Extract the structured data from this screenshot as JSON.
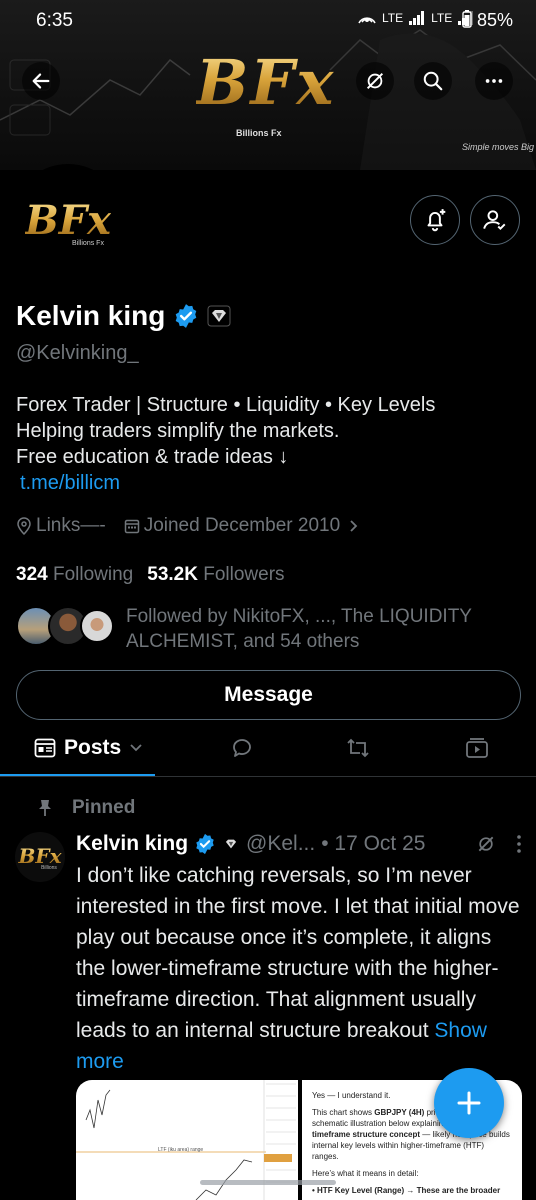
{
  "status_bar": {
    "time": "6:35",
    "network": "LTE",
    "network2": "LTE",
    "battery": "85%"
  },
  "banner": {
    "logo": "BFx",
    "logo_sub": "Billions Fx",
    "tagline": "Simple moves Big wi"
  },
  "avatar": {
    "logo": "BFx",
    "sub": "Billions Fx"
  },
  "profile": {
    "name": "Kelvin king",
    "handle": "@Kelvinking_",
    "bio_line1": "Forex Trader | Structure • Liquidity • Key Levels",
    "bio_line2": "Helping traders simplify the markets.",
    "bio_line3": "Free education & trade ideas ↓",
    "bio_link": "t.me/billicm",
    "location": "Links—-",
    "joined": "Joined December 2010",
    "following_count": "324",
    "following_label": "Following",
    "followers_count": "53.2K",
    "followers_label": "Followers",
    "followed_by": "Followed by NikitoFX, ..., The LIQUIDITY ALCHEMIST, and 54 others"
  },
  "actions": {
    "message_label": "Message"
  },
  "tabs": {
    "posts_label": "Posts"
  },
  "pinned": {
    "label": "Pinned"
  },
  "post": {
    "avatar_logo": "BFx",
    "avatar_sub": "Billions",
    "name": "Kelvin king",
    "handle": "@Kel...",
    "date": "• 17 Oct 25",
    "text": "I don’t like catching reversals, so I’m never interested in the first move. I let that initial move play out because once it’s complete, it aligns the lower-timeframe structure with the higher-timeframe direction. That alignment usually leads to an internal structure breakout",
    "show_more": "Show more",
    "media_chart_label": "LTF (iku area) range",
    "media_para1": "Yes — I understand it.",
    "media_para2a": "This chart shows ",
    "media_para2b": "GBPJPY (4H)",
    "media_para2c": " price action and a schematic illustration below explaining a ",
    "media_para2d": "multi-timeframe structure concept",
    "media_para2e": " — likely how price builds internal key levels within higher-timeframe (HTF) ranges.",
    "media_para3": "Here’s what it means in detail:",
    "media_para4": "• HTF Key Level (Range) → These are the broader"
  },
  "colors": {
    "accent": "#1d9bf0",
    "muted": "#71767b",
    "gold": "#d9a43b"
  },
  "icons": {
    "back": "arrow-left-icon",
    "grok": "grok-icon",
    "search": "search-icon",
    "more": "more-horizontal-icon",
    "notify": "bell-plus-icon",
    "follow": "user-check-icon",
    "verified": "verified-badge-icon",
    "affiliate": "affiliate-badge-icon"
  }
}
